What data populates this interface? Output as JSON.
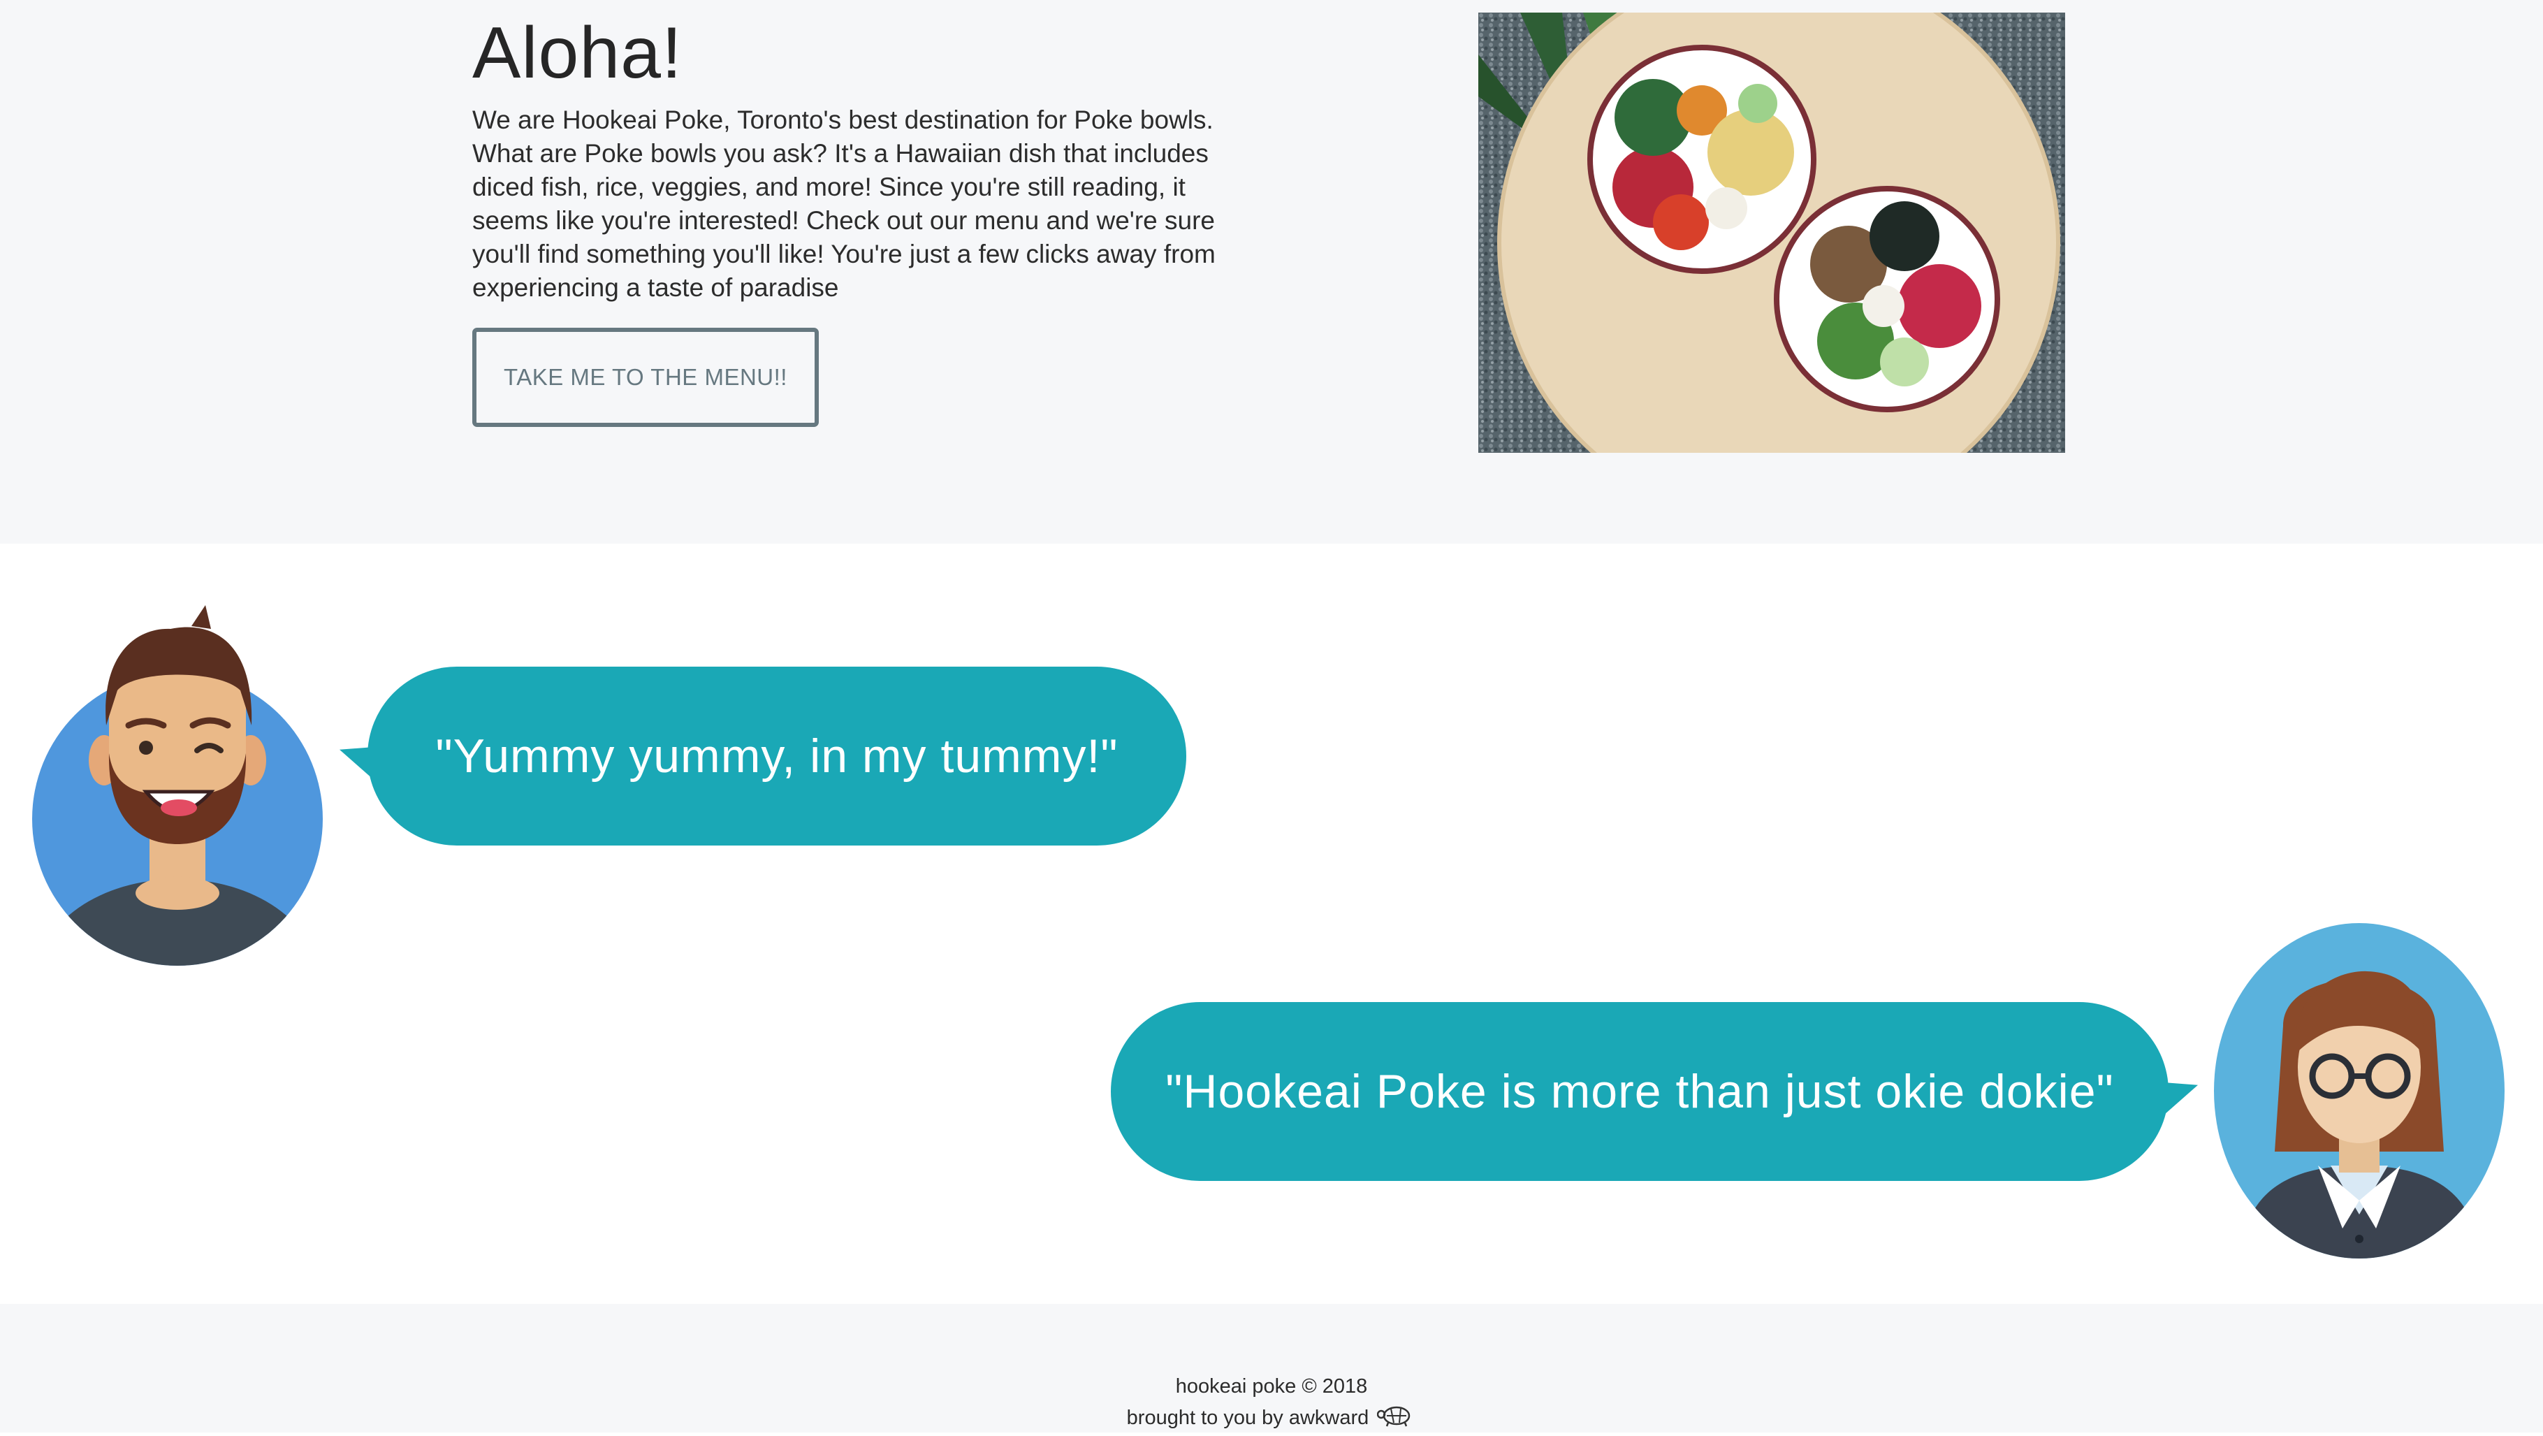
{
  "hero": {
    "title": "Aloha!",
    "text": "We are Hookeai Poke, Toronto's best destination for Poke bowls. What are Poke bowls you ask? It's a Hawaiian dish that includes diced fish, rice, veggies, and more! Since you're still reading, it seems like you're interested! Check out our menu and we're sure you'll find something you'll like! You're just a few clicks away from experiencing a taste of paradise",
    "button_label": "TAKE ME TO THE MENU!!",
    "image_icon": "poke-bowls-photo"
  },
  "testimonials": [
    {
      "quote": "\"Yummy yummy, in my tummy!\"",
      "avatar": "bearded-man-avatar"
    },
    {
      "quote": "\"Hookeai Poke is more than just okie dokie\"",
      "avatar": "woman-with-glasses-avatar"
    }
  ],
  "footer": {
    "copyright": "hookeai poke © 2018",
    "credit": "brought to you by awkward",
    "credit_icon": "turtle-icon"
  },
  "colors": {
    "accent": "#1aa8b6",
    "button_border": "#667880",
    "section_bg": "#f6f7f9"
  }
}
